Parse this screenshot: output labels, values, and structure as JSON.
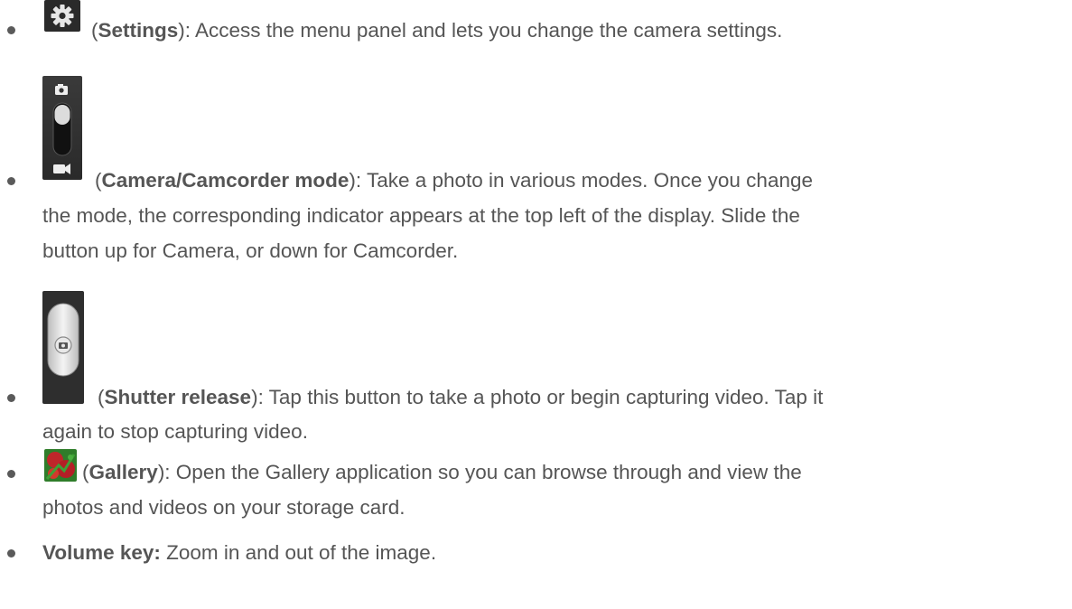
{
  "items": [
    {
      "icon": "settings-gear-icon",
      "title": "Settings",
      "lines": [
        "): Access the menu panel and lets you change the camera settings."
      ]
    },
    {
      "icon": "camera-camcorder-switch-icon",
      "title": "Camera/Camcorder mode",
      "lines": [
        "): Take a photo in various modes. Once you change",
        "the mode, the corresponding indicator appears at the top left of the display. Slide the",
        "button up for Camera, or down for Camcorder."
      ]
    },
    {
      "icon": "shutter-release-icon",
      "title": "Shutter release",
      "lines": [
        "): Tap this button to take a photo or begin capturing video. Tap it",
        "again to stop capturing video."
      ]
    },
    {
      "icon": "gallery-thumbnail-icon",
      "title": "Gallery",
      "lines": [
        "): Open the Gallery application so you can browse through and view the",
        "photos and videos on your storage card."
      ]
    },
    {
      "title": "Volume key:",
      "lines": [
        " Zoom in and out of the image."
      ]
    }
  ]
}
